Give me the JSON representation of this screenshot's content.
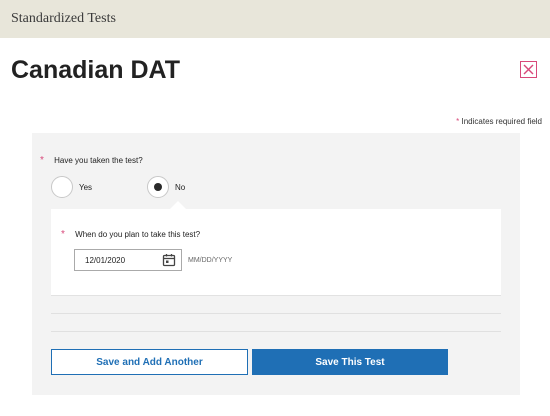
{
  "header": {
    "breadcrumb": "Standardized Tests"
  },
  "page": {
    "title": "Canadian DAT",
    "close_icon": "close-icon"
  },
  "required_note": {
    "star": "*",
    "text": "Indicates required field"
  },
  "question_taken": {
    "star": "*",
    "label": "Have you taken the test?",
    "options": [
      {
        "label": "Yes",
        "selected": false
      },
      {
        "label": "No",
        "selected": true
      }
    ]
  },
  "question_plan": {
    "star": "*",
    "label": "When do you plan to take this test?",
    "date_value": "12/01/2020",
    "date_format_hint": "MM/DD/YYYY",
    "calendar_icon": "calendar-icon"
  },
  "buttons": {
    "save_add_another": "Save and Add Another",
    "save_this_test": "Save This Test"
  },
  "colors": {
    "accent_blue": "#1f6fb5",
    "required_pink": "#d8497a",
    "topbar_bg": "#e8e6da",
    "card_bg": "#f3f3f3"
  }
}
